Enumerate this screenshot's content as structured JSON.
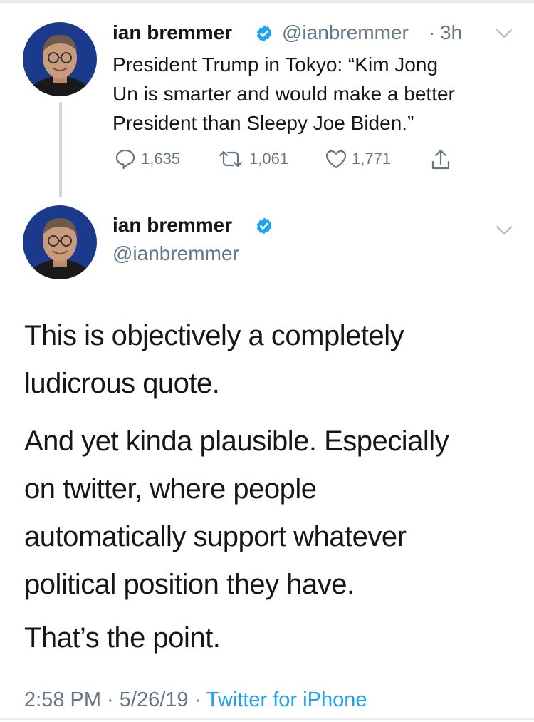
{
  "tweet1": {
    "name": "ian bremmer",
    "handle": "@ianbremmer",
    "dot": "·",
    "time": "3h",
    "text_lines": [
      "President Trump in Tokyo: “Kim Jong",
      "Un is smarter and would make a better",
      "President than Sleepy Joe Biden.”"
    ],
    "replies": "1,635",
    "retweets": "1,061",
    "likes": "1,771"
  },
  "tweet2": {
    "name": "ian bremmer",
    "handle": "@ianbremmer",
    "paragraphs": [
      [
        "This is objectively a completely",
        "ludicrous quote."
      ],
      [
        "And yet kinda plausible. Especially",
        "on twitter, where people",
        "automatically support whatever",
        "political position they have."
      ],
      [
        "That’s the point."
      ]
    ],
    "footer": {
      "time": "2:58 PM",
      "sep1": " · ",
      "date": "5/26/19",
      "sep2": " · ",
      "source": "Twitter for iPhone"
    }
  },
  "colors": {
    "text": "#14171a",
    "secondary": "#657786",
    "accent": "#1da1f2",
    "divider": "#ccd6dd"
  },
  "icons": [
    "verified-badge-icon",
    "chevron-down-icon",
    "reply-icon",
    "retweet-icon",
    "like-icon",
    "share-icon"
  ]
}
